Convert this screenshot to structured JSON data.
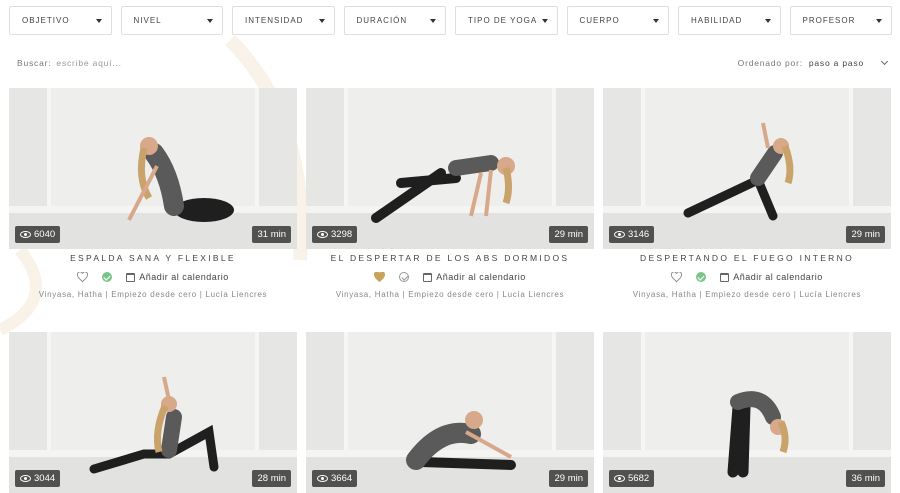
{
  "filters": [
    "Objetivo",
    "Nivel",
    "Intensidad",
    "Duración",
    "Tipo de yoga",
    "Cuerpo",
    "Habilidad",
    "Profesor"
  ],
  "search": {
    "label": "Buscar:",
    "placeholder": "escribe aquí..."
  },
  "sort": {
    "label": "Ordenado por:",
    "value": "paso a paso"
  },
  "colors": {
    "liked": "#c9a35c",
    "completed": "#7bc48a",
    "border": "#dedede"
  },
  "calendar_label": "Añadir al calendario",
  "classes": [
    {
      "title": "Espalda sana y flexible",
      "views": "6040",
      "duration": "31 min",
      "liked": false,
      "completed": true,
      "tags": [
        "Vinyasa, Hatha",
        "Empiezo desde cero",
        "Lucía Liencres"
      ],
      "pose": "backbend"
    },
    {
      "title": "El despertar de los abs dormidos",
      "views": "3298",
      "duration": "29 min",
      "liked": true,
      "completed": false,
      "tags": [
        "Vinyasa, Hatha",
        "Empiezo desde cero",
        "Lucía Liencres"
      ],
      "pose": "plank"
    },
    {
      "title": "Despertando el fuego interno",
      "views": "3146",
      "duration": "29 min",
      "liked": false,
      "completed": true,
      "tags": [
        "Vinyasa, Hatha",
        "Empiezo desde cero",
        "Lucía Liencres"
      ],
      "pose": "balance"
    },
    {
      "title": "",
      "views": "3044",
      "duration": "28 min",
      "liked": false,
      "completed": false,
      "tags": [],
      "pose": "lunge"
    },
    {
      "title": "",
      "views": "3664",
      "duration": "29 min",
      "liked": false,
      "completed": false,
      "tags": [],
      "pose": "forward-fold-seated"
    },
    {
      "title": "",
      "views": "5682",
      "duration": "36 min",
      "liked": false,
      "completed": false,
      "tags": [],
      "pose": "forward-fold-standing"
    }
  ]
}
